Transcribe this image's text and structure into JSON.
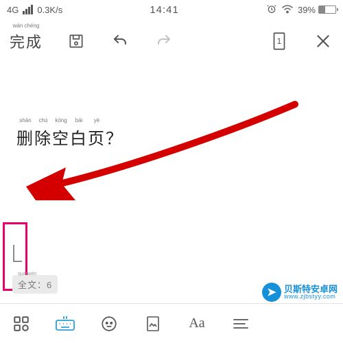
{
  "status": {
    "network": "4G",
    "speed": "0.3K/s",
    "time": "14:41",
    "battery_pct": "39%"
  },
  "toolbar": {
    "done_label": "完成",
    "done_pinyin": "wán chéng",
    "page_number": "1"
  },
  "content": {
    "headline_chars": [
      "删",
      "除",
      "空",
      "白",
      "页"
    ],
    "headline_pinyin": [
      "shān",
      "chú",
      "kōng",
      "bái",
      "yè"
    ],
    "headline_suffix": "？"
  },
  "word_count": {
    "label_chars": [
      "全",
      "文"
    ],
    "label_pinyin": [
      "quán",
      "wén"
    ],
    "separator": "：",
    "value": "6"
  },
  "watermark": {
    "name": "贝斯特安卓网",
    "url": "www.zjbstyy.com"
  },
  "icons": {
    "save": "save-icon",
    "undo": "undo-icon",
    "redo": "redo-icon",
    "page": "page-icon",
    "close": "close-icon",
    "grid": "grid-icon",
    "keyboard": "keyboard-icon",
    "face": "face-icon",
    "image": "image-icon",
    "font": "Aa",
    "menu": "menu-icon"
  }
}
